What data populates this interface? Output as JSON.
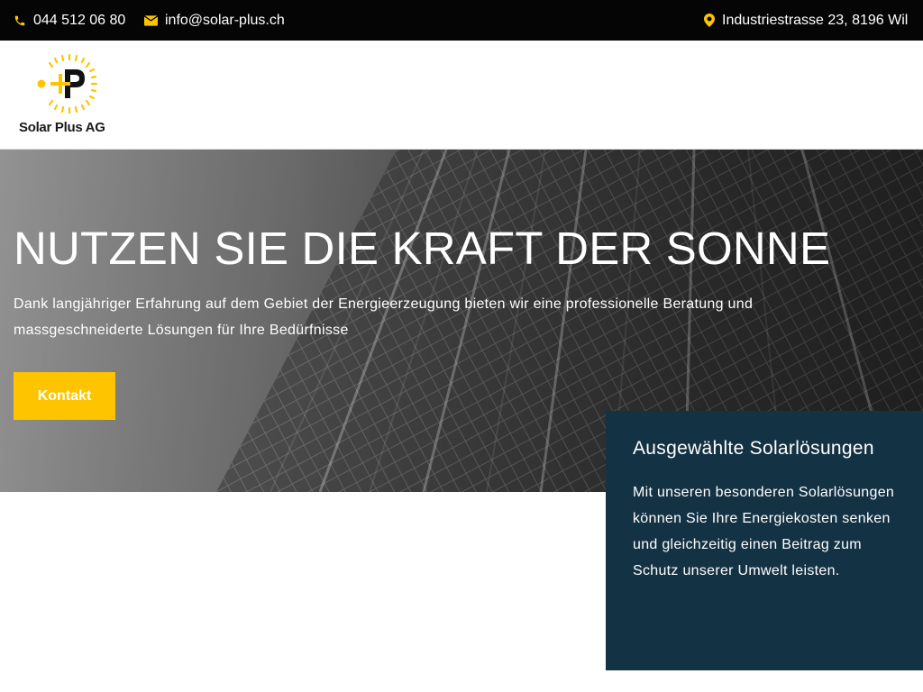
{
  "topbar": {
    "phone": "044 512 06 80",
    "email": "info@solar-plus.ch",
    "address": "Industriestrasse 23, 8196 Wil"
  },
  "header": {
    "logo_text": "Solar Plus AG"
  },
  "hero": {
    "title": "NUTZEN SIE DIE KRAFT DER SONNE",
    "text": "Dank langjähriger Erfahrung auf dem Gebiet der Energieerzeugung bieten wir eine professionelle Beratung und massgeschneiderte Lösungen für Ihre Bedürfnisse",
    "cta_label": "Kontakt"
  },
  "feature": {
    "title": "Ausgewählte Solarlösungen",
    "text": "Mit unseren besonderen Solarlösungen können Sie Ihre Energiekosten senken und gleichzeitig einen Beitrag zum Schutz unserer Umwelt leisten."
  },
  "colors": {
    "topbar_bg": "#050505",
    "accent_yellow": "#ffc400",
    "feature_bg": "#133244"
  },
  "icons": {
    "phone": "phone-icon",
    "email": "envelope-icon",
    "address": "map-pin-icon"
  }
}
